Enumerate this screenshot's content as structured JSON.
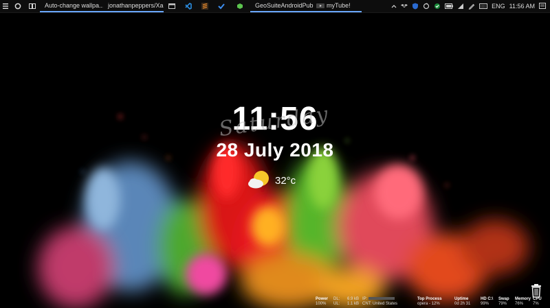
{
  "taskbar": {
    "apps": [
      {
        "label": "Auto-change wallpa...",
        "icon": "folder-icon",
        "color": "#1a9e8a"
      },
      {
        "label": "jonathanpeppers/Xa...",
        "icon": "opera-icon",
        "color": "#e0213b"
      },
      {
        "label": "",
        "icon": "app-window-icon"
      },
      {
        "label": "",
        "icon": "vscode-icon",
        "color": "#2b8de0"
      },
      {
        "label": "",
        "icon": "sublime-icon",
        "color": "#e0862b"
      },
      {
        "label": "",
        "icon": "todo-check-icon",
        "color": "#3d8ef0"
      },
      {
        "label": "",
        "icon": "cube-icon",
        "color": "#5cc44f"
      },
      {
        "label": "GeoSuiteAndroidPub...",
        "icon": "android-icon",
        "color": "#7bc043"
      },
      {
        "label": "myTube!",
        "icon": "mytube-icon"
      }
    ],
    "tray": {
      "language": "ENG",
      "time": "11:56 AM"
    }
  },
  "desktop": {
    "time": "11:56",
    "day": "Saturday",
    "date": "28 July 2018",
    "temperature": "32°c",
    "weather_icon": "sun-cloud-icon"
  },
  "system_stats": {
    "power_label": "Power",
    "power_value": "100%",
    "dl_label": "DL:",
    "dl_value": "6.9 kB",
    "ul_label": "UL:",
    "ul_value": "1.1 kB",
    "ip_label": "IP:",
    "cnt_label": "CNT: United States",
    "top_process_label": "Top Process",
    "top_process_value": "opera - 12%",
    "uptime_label": "Uptime",
    "uptime_value": "0d 2h 31",
    "hd_label": "HD C:\\",
    "hd_value": "99%",
    "swap_label": "Swap",
    "swap_value": "79%",
    "memory_label": "Memory",
    "memory_value": "76%",
    "cpu_label": "CPU",
    "cpu_value": "7%"
  }
}
